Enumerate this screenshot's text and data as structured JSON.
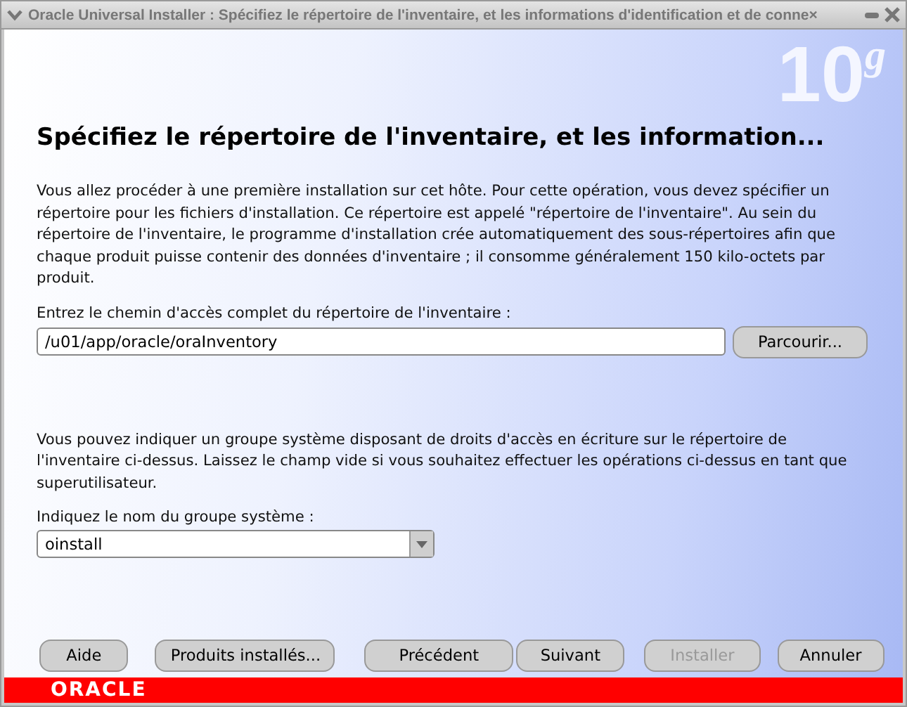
{
  "window": {
    "title": "Oracle Universal Installer : Spécifiez le répertoire de l'inventaire, et les informations d'identification et de conne×"
  },
  "logo_mark": "10$^{g}$",
  "heading": "Spécifiez le répertoire de l'inventaire, et les information...",
  "intro": "Vous allez procéder à une première installation sur cet hôte. Pour cette opération, vous devez spécifier un répertoire pour les fichiers d'installation. Ce répertoire est appelé \"répertoire de l'inventaire\". Au sein du répertoire de l'inventaire, le programme d'installation crée automatiquement des sous-répertoires afin que chaque produit puisse contenir des données d'inventaire ; il consomme généralement 150 kilo-octets par produit.",
  "path_field": {
    "label": "Entrez le chemin d'accès complet du répertoire de l'inventaire :",
    "value": "/u01/app/oracle/oraInventory",
    "browse_button": "Parcourir..."
  },
  "group_note": "Vous pouvez indiquer un groupe système disposant de droits d'accès en écriture sur le répertoire de l'inventaire ci-dessus. Laissez le champ vide si vous souhaitez effectuer les opérations ci-dessus en tant que superutilisateur.",
  "group_field": {
    "label": "Indiquez le nom du groupe système :",
    "value": "oinstall"
  },
  "buttons": [
    {
      "label": "Aide",
      "disabled": false
    },
    {
      "label": "Produits installés...",
      "disabled": false
    },
    {
      "label": "Précédent",
      "disabled": false
    },
    {
      "label": "Suivant",
      "disabled": false
    },
    {
      "label": "Installer",
      "disabled": true
    },
    {
      "label": "Annuler",
      "disabled": false
    }
  ],
  "footer": {
    "logo": "ORACLE"
  }
}
